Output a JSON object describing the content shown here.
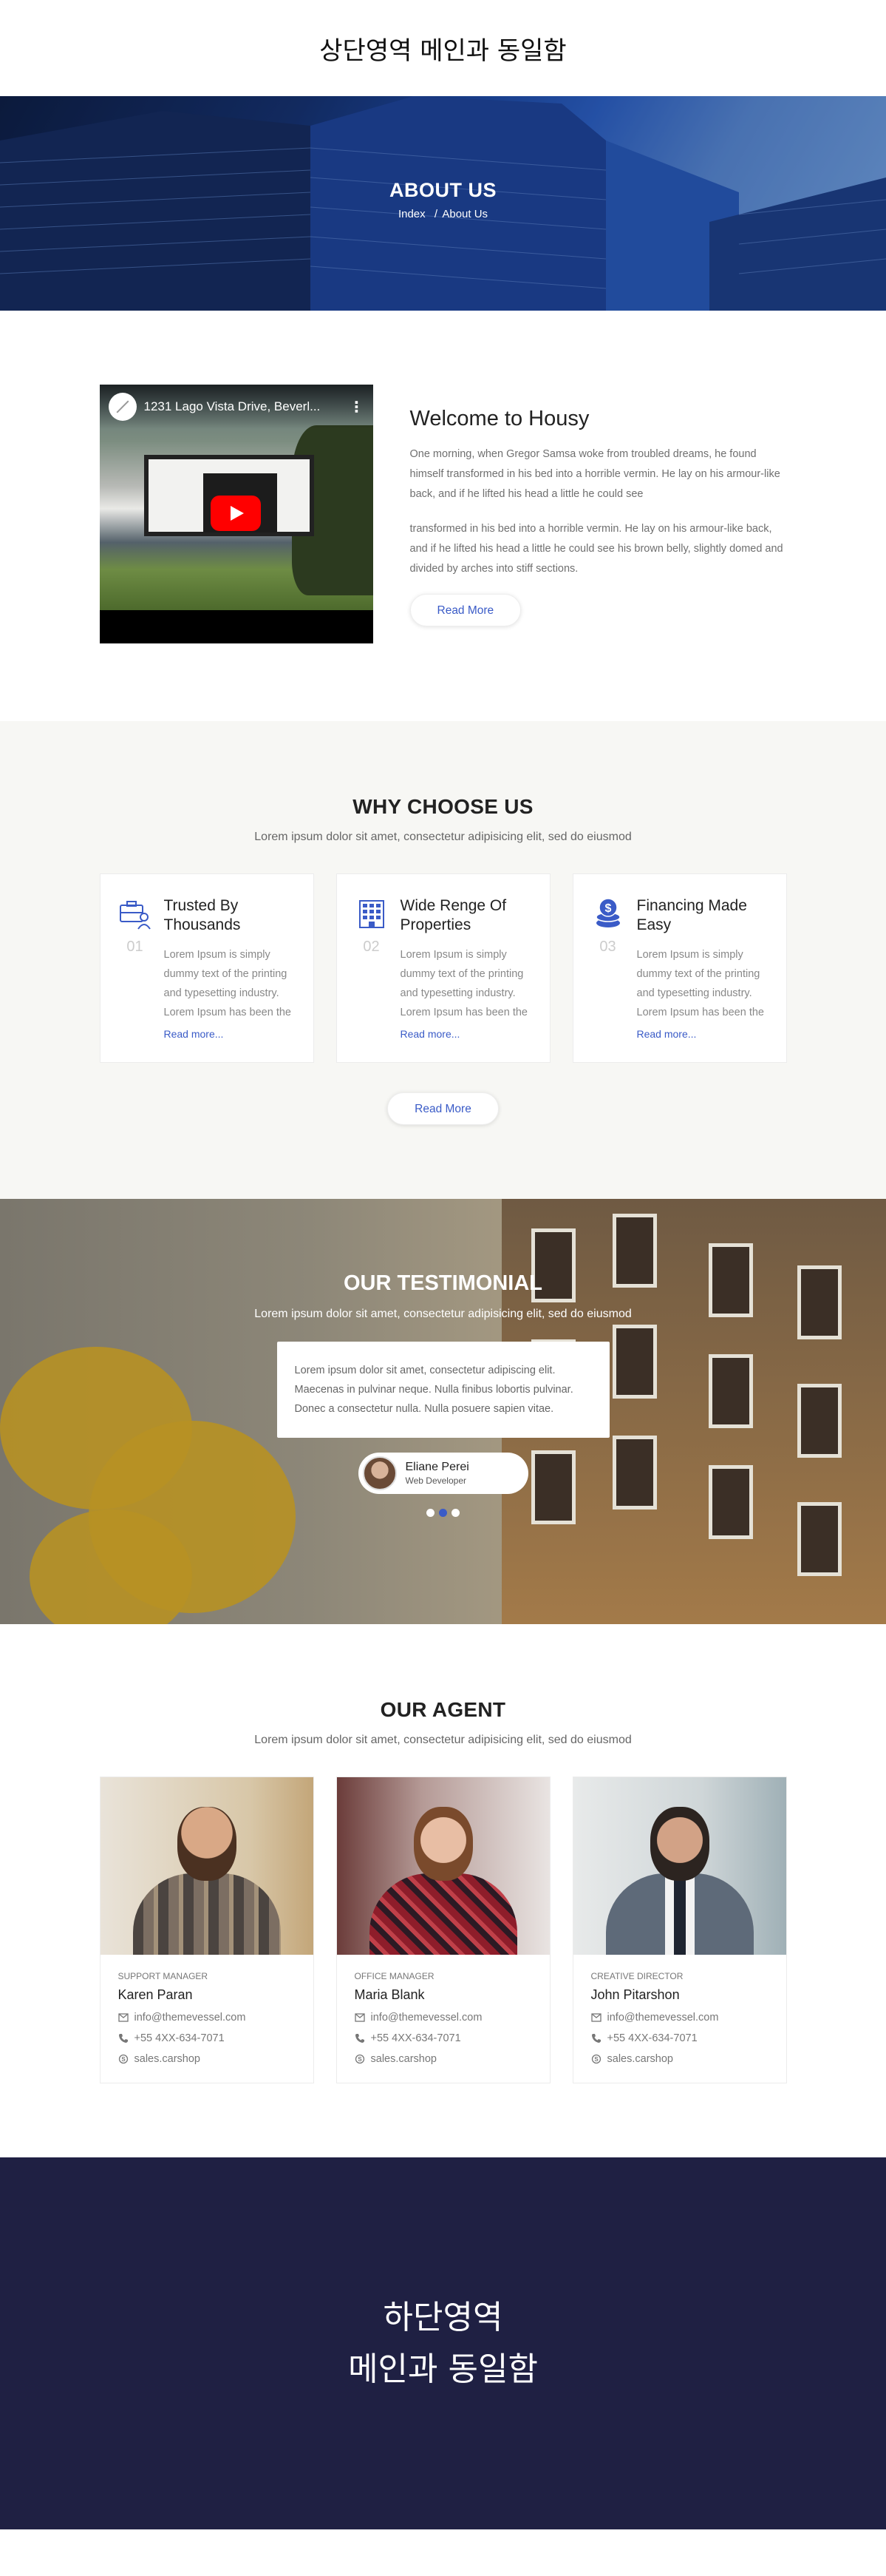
{
  "header": {
    "text": "상단영역 메인과 동일함"
  },
  "hero": {
    "title": "ABOUT US",
    "crumb_home": "Index",
    "crumb_sep": "/",
    "crumb_current": "About Us"
  },
  "welcome": {
    "video_title": "1231 Lago Vista Drive, Beverl...",
    "title": "Welcome to Housy",
    "para1": "One morning, when Gregor Samsa woke from troubled dreams, he found himself transformed in his bed into a horrible vermin. He lay on his armour-like back, and if he lifted his head a little he could see",
    "para2": "transformed in his bed into a horrible vermin. He lay on his armour-like back, and if he lifted his head a little he could see his brown belly, slightly domed and divided by arches into stiff sections.",
    "button": "Read More"
  },
  "why": {
    "title": "WHY CHOOSE US",
    "subtitle": "Lorem ipsum dolor sit amet, consectetur adipisicing elit, sed do eiusmod",
    "cards": [
      {
        "num": "01",
        "title": "Trusted By Thousands",
        "text": "Lorem Ipsum is simply dummy text of the printing and typesetting industry. Lorem Ipsum has been the",
        "link": "Read more..."
      },
      {
        "num": "02",
        "title": "Wide Renge Of Properties",
        "text": "Lorem Ipsum is simply dummy text of the printing and typesetting industry. Lorem Ipsum has been the",
        "link": "Read more..."
      },
      {
        "num": "03",
        "title": "Financing Made Easy",
        "text": "Lorem Ipsum is simply dummy text of the printing and typesetting industry. Lorem Ipsum has been the",
        "link": "Read more..."
      }
    ],
    "button": "Read More"
  },
  "testimonial": {
    "title": "OUR TESTIMONIAL",
    "subtitle": "Lorem ipsum dolor sit amet, consectetur adipisicing elit, sed do eiusmod",
    "quote": "Lorem ipsum dolor sit amet, consectetur adipiscing elit. Maecenas in pulvinar neque. Nulla finibus lobortis pulvinar. Donec a consectetur nulla. Nulla posuere sapien vitae.",
    "name": "Eliane Perei",
    "role": "Web Developer"
  },
  "agents": {
    "title": "OUR AGENT",
    "subtitle": "Lorem ipsum dolor sit amet, consectetur adipisicing elit, sed do eiusmod",
    "list": [
      {
        "role": "SUPPORT MANAGER",
        "name": "Karen Paran",
        "email": "info@themevessel.com",
        "phone": "+55 4XX-634-7071",
        "skype": "sales.carshop"
      },
      {
        "role": "OFFICE MANAGER",
        "name": "Maria Blank",
        "email": "info@themevessel.com",
        "phone": "+55 4XX-634-7071",
        "skype": "sales.carshop"
      },
      {
        "role": "CREATIVE DIRECTOR",
        "name": "John Pitarshon",
        "email": "info@themevessel.com",
        "phone": "+55 4XX-634-7071",
        "skype": "sales.carshop"
      }
    ]
  },
  "footer": {
    "line1": "하단영역",
    "line2": "메인과 동일함"
  },
  "colors": {
    "accent": "#3a5bc7",
    "footer_bg": "#1f2043",
    "section_bg": "#f7f7f4"
  }
}
